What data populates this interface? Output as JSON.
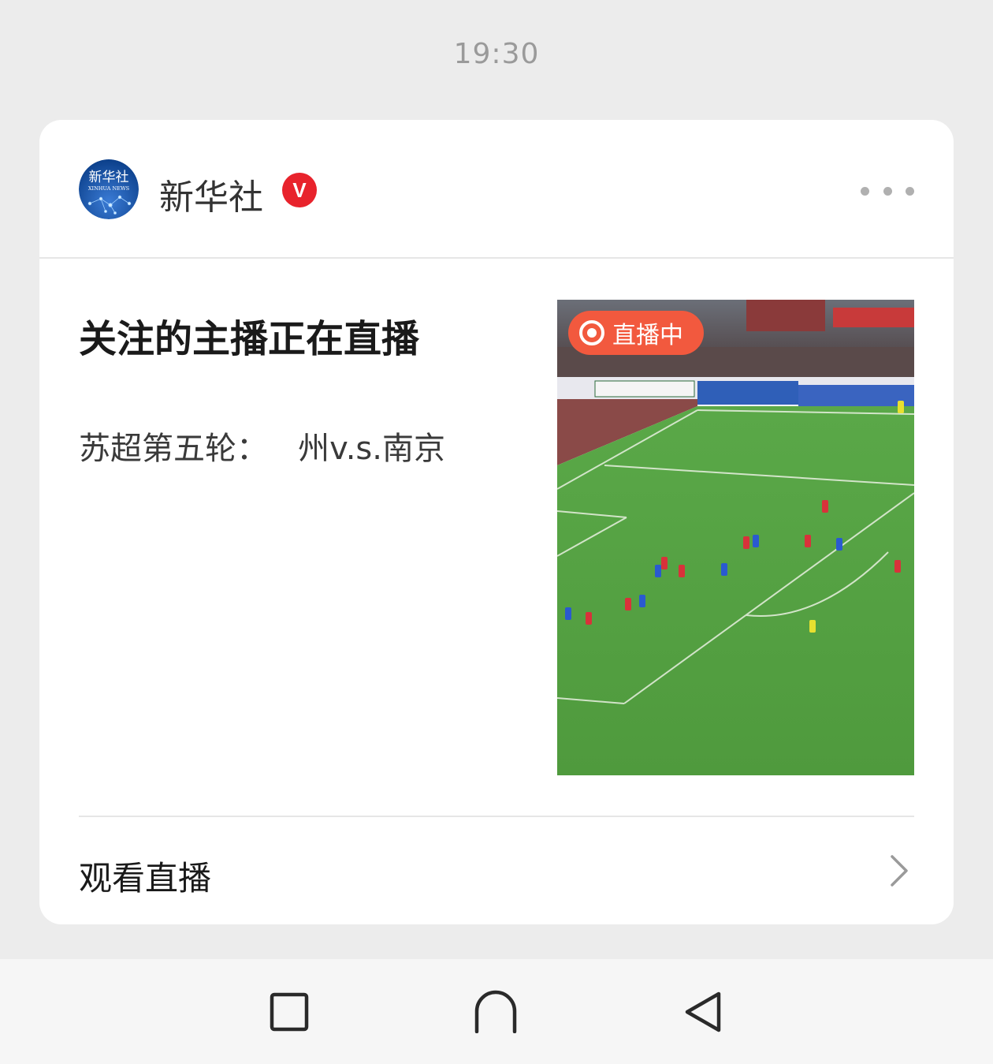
{
  "status_bar": {
    "time": "19:30"
  },
  "card": {
    "account": {
      "name": "新华社",
      "verified_badge": "V",
      "avatar_text": "新华社",
      "avatar_subtext": "XINHUA NEWS"
    },
    "headline": "关注的主播正在直播",
    "subline": "苏超第五轮：   州v.s.南京",
    "thumbnail": {
      "live_badge": "直播中",
      "icon": "football-match-thumbnail"
    },
    "action": {
      "label": "观看直播",
      "icon": "chevron-right-icon"
    }
  },
  "nav_bar": {
    "buttons": [
      "recent-apps-icon",
      "home-icon",
      "back-icon"
    ]
  },
  "colors": {
    "live_badge": "#f2593e",
    "verified": "#e8232c",
    "background": "#ececec"
  }
}
